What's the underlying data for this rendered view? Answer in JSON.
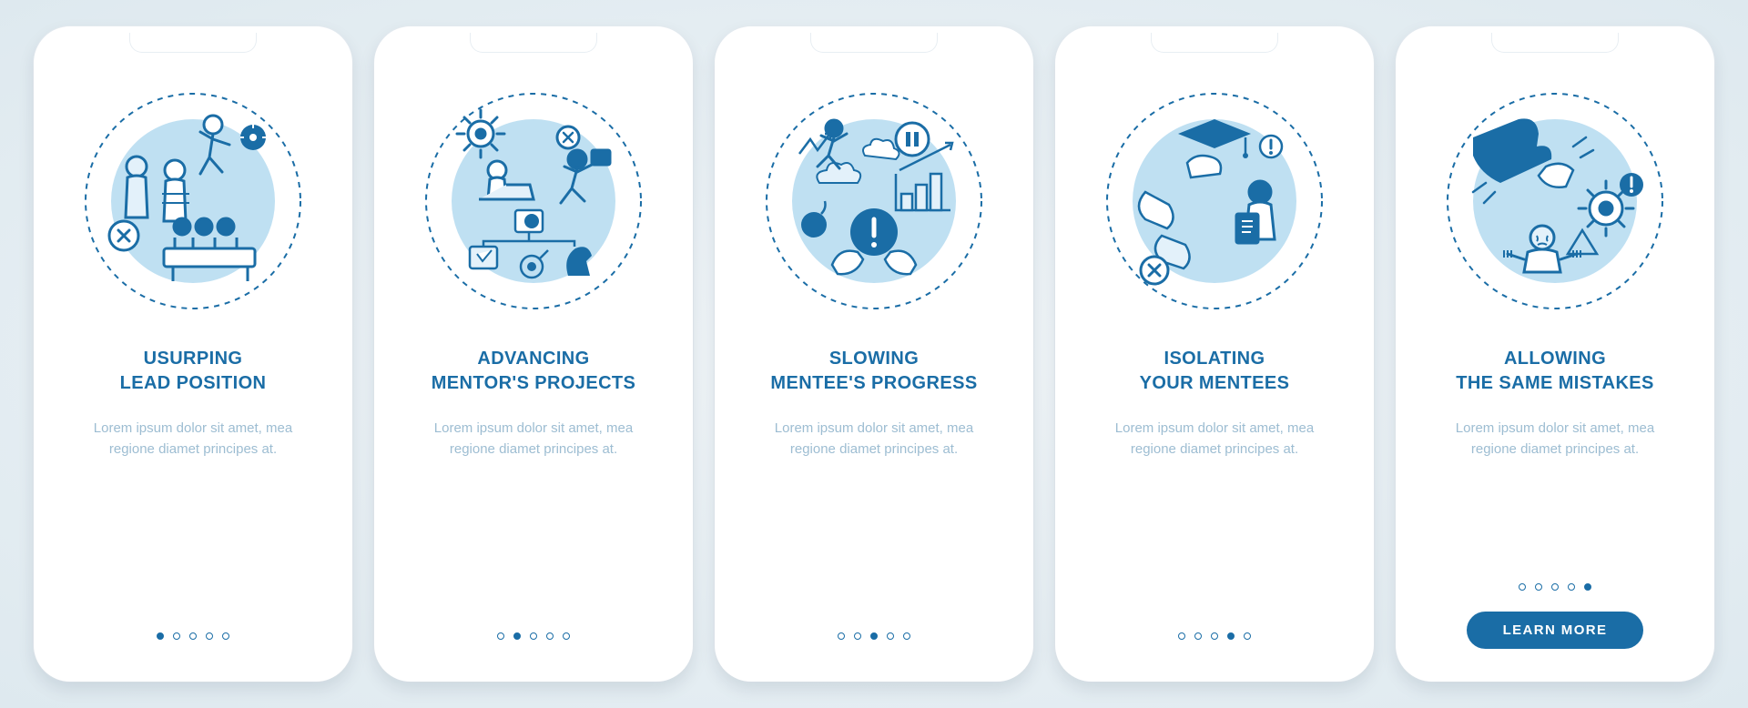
{
  "colors": {
    "primary": "#1a6da6",
    "tint": "#bfe0f2",
    "pale": "#e3f1fa",
    "muted_text": "#9dbdd2"
  },
  "screens": [
    {
      "icon": "usurping-lead-icon",
      "title": "USURPING\nLEAD POSITION",
      "body": "Lorem ipsum dolor sit amet, mea regione diamet principes at.",
      "activeDot": 0
    },
    {
      "icon": "advancing-projects-icon",
      "title": "ADVANCING\nMENTOR'S PROJECTS",
      "body": "Lorem ipsum dolor sit amet, mea regione diamet principes at.",
      "activeDot": 1
    },
    {
      "icon": "slowing-progress-icon",
      "title": "SLOWING\nMENTEE'S PROGRESS",
      "body": "Lorem ipsum dolor sit amet, mea regione diamet principes at.",
      "activeDot": 2
    },
    {
      "icon": "isolating-mentees-icon",
      "title": "ISOLATING\nYOUR MENTEES",
      "body": "Lorem ipsum dolor sit amet, mea regione diamet principes at.",
      "activeDot": 3
    },
    {
      "icon": "allowing-mistakes-icon",
      "title": "ALLOWING\nTHE SAME MISTAKES",
      "body": "Lorem ipsum dolor sit amet, mea regione diamet principes at.",
      "activeDot": 4,
      "cta": "LEARN MORE"
    }
  ],
  "totalDots": 5
}
